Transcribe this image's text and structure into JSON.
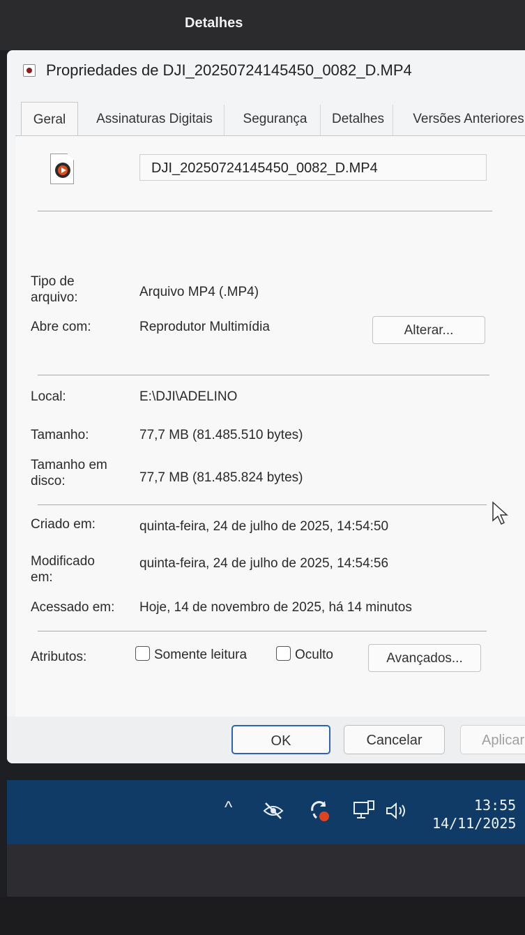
{
  "top_window": {
    "title": "Detalhes"
  },
  "dialog": {
    "title": "Propriedades de DJI_20250724145450_0082_D.MP4",
    "tabs": [
      {
        "label": "Geral",
        "active": true
      },
      {
        "label": "Assinaturas Digitais"
      },
      {
        "label": "Segurança"
      },
      {
        "label": "Detalhes"
      },
      {
        "label": "Versões Anteriores"
      }
    ],
    "file_name": "DJI_20250724145450_0082_D.MP4",
    "fields": {
      "type_label": "Tipo de arquivo:",
      "type_value": "Arquivo MP4 (.MP4)",
      "opens_label": "Abre com:",
      "opens_value": "Reprodutor Multimídia",
      "change_button": "Alterar...",
      "location_label": "Local:",
      "location_value": "E:\\DJI\\ADELINO",
      "size_label": "Tamanho:",
      "size_value": "77,7 MB (81.485.510 bytes)",
      "disk_size_label": "Tamanho em disco:",
      "disk_size_value": "77,7 MB (81.485.824 bytes)",
      "created_label": "Criado em:",
      "created_value": "quinta-feira, 24 de julho de 2025, 14:54:50",
      "modified_label": "Modificado em:",
      "modified_value": "quinta-feira, 24 de julho de 2025, 14:54:56",
      "accessed_label": "Acessado em:",
      "accessed_value": "Hoje, 14 de novembro de 2025, há 14 minutos",
      "attributes_label": "Atributos:",
      "readonly_label": "Somente leitura",
      "hidden_label": "Oculto",
      "advanced_button": "Avançados..."
    },
    "footer": {
      "ok": "OK",
      "cancel": "Cancelar",
      "apply": "Aplicar"
    }
  },
  "taskbar": {
    "time": "13:55",
    "date": "14/11/2025",
    "icons": [
      "chevron-up-icon",
      "eye-off-icon",
      "sync-record-icon",
      "network-icon",
      "speaker-icon"
    ]
  }
}
